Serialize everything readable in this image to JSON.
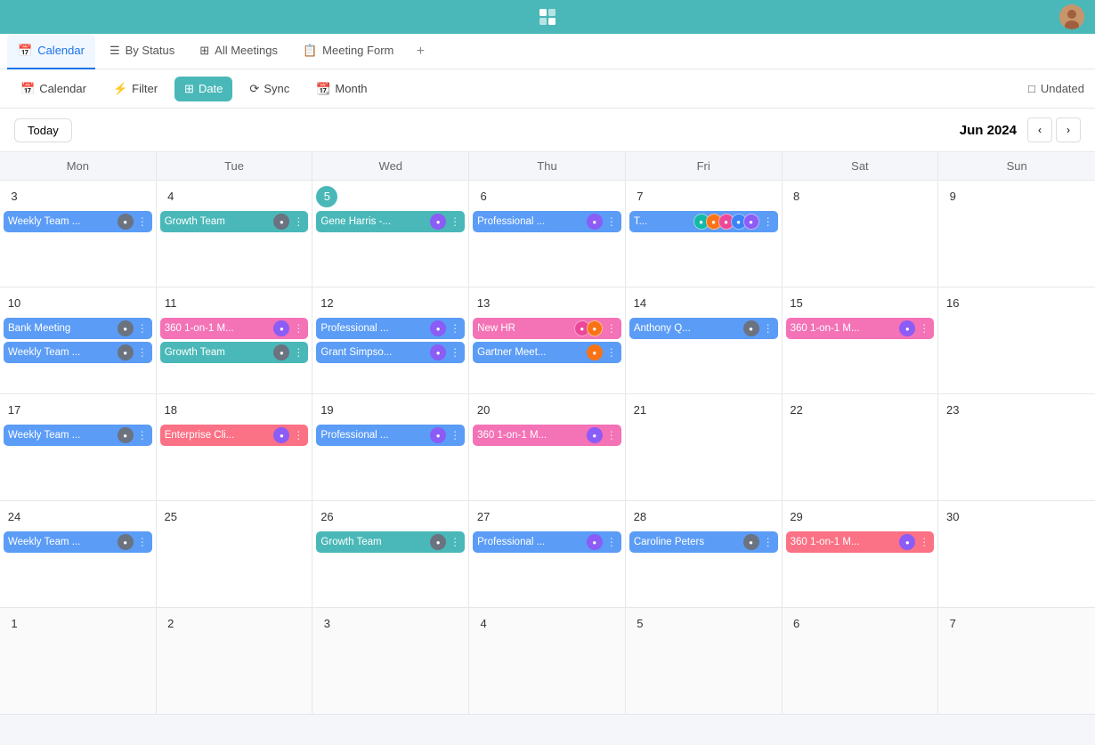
{
  "topbar": {
    "logo": "⊞",
    "avatar_alt": "User Avatar"
  },
  "tabs": [
    {
      "id": "calendar",
      "label": "Calendar",
      "icon": "📅",
      "active": true
    },
    {
      "id": "by-status",
      "label": "By Status",
      "icon": "☰"
    },
    {
      "id": "all-meetings",
      "label": "All Meetings",
      "icon": "⊞"
    },
    {
      "id": "meeting-form",
      "label": "Meeting Form",
      "icon": "📋"
    }
  ],
  "tab_add": "+",
  "toolbar": {
    "calendar_btn": "Calendar",
    "filter_btn": "Filter",
    "date_btn": "Date",
    "sync_btn": "Sync",
    "month_btn": "Month",
    "undated_btn": "Undated"
  },
  "calendar": {
    "today_btn": "Today",
    "title": "Jun 2024",
    "nav_prev": "‹",
    "nav_next": "›",
    "days": [
      "Mon",
      "Tue",
      "Wed",
      "Thu",
      "Fri",
      "Sat",
      "Sun"
    ]
  },
  "weeks": [
    {
      "days": [
        {
          "num": "3",
          "events": [
            {
              "label": "Weekly Team ...",
              "color": "ev-blue",
              "av_color": "av-gray",
              "has_menu": true
            }
          ]
        },
        {
          "num": "4",
          "events": [
            {
              "label": "Growth Team",
              "color": "ev-teal",
              "av_color": "av-gray",
              "has_menu": true
            }
          ]
        },
        {
          "num": "5",
          "today": true,
          "events": [
            {
              "label": "Gene Harris -...",
              "color": "ev-teal",
              "av_color": "av-purple",
              "has_menu": true
            }
          ]
        },
        {
          "num": "6",
          "events": [
            {
              "label": "Professional ...",
              "color": "ev-blue",
              "av_color": "av-purple",
              "has_menu": true
            }
          ]
        },
        {
          "num": "7",
          "events": [
            {
              "label": "T...",
              "color": "ev-blue",
              "multi_av": true,
              "has_menu": true
            }
          ]
        },
        {
          "num": "8",
          "events": []
        },
        {
          "num": "9",
          "events": []
        }
      ]
    },
    {
      "days": [
        {
          "num": "10",
          "events": [
            {
              "label": "Bank Meeting",
              "color": "ev-blue",
              "av_color": "av-gray",
              "has_menu": true
            },
            {
              "label": "Weekly Team ...",
              "color": "ev-blue",
              "av_color": "av-gray",
              "has_menu": true
            }
          ]
        },
        {
          "num": "11",
          "events": [
            {
              "label": "360 1-on-1 M...",
              "color": "ev-pink",
              "av_color": "av-purple",
              "has_menu": true
            },
            {
              "label": "Growth Team",
              "color": "ev-teal",
              "av_color": "av-gray",
              "has_menu": true
            }
          ]
        },
        {
          "num": "12",
          "events": [
            {
              "label": "Professional ...",
              "color": "ev-blue",
              "av_color": "av-purple",
              "has_menu": true
            },
            {
              "label": "Grant Simpso...",
              "color": "ev-blue",
              "av_color": "av-purple",
              "has_menu": true
            }
          ]
        },
        {
          "num": "13",
          "events": [
            {
              "label": "New HR",
              "color": "ev-pink",
              "multi_av2": true,
              "has_menu": true
            },
            {
              "label": "Gartner Meet...",
              "color": "ev-blue",
              "av_color": "av-orange",
              "has_menu": true
            }
          ]
        },
        {
          "num": "14",
          "events": [
            {
              "label": "Anthony Q...",
              "color": "ev-blue",
              "av_color": "av-gray",
              "has_menu": true
            }
          ]
        },
        {
          "num": "15",
          "events": [
            {
              "label": "360 1-on-1 M...",
              "color": "ev-pink",
              "av_color": "av-purple",
              "has_menu": true
            }
          ]
        },
        {
          "num": "16",
          "events": []
        }
      ]
    },
    {
      "days": [
        {
          "num": "17",
          "events": [
            {
              "label": "Weekly Team ...",
              "color": "ev-blue",
              "av_color": "av-gray",
              "has_menu": true
            }
          ]
        },
        {
          "num": "18",
          "events": [
            {
              "label": "Enterprise Cli...",
              "color": "ev-coral",
              "av_color": "av-purple",
              "has_menu": true
            }
          ]
        },
        {
          "num": "19",
          "events": [
            {
              "label": "Professional ...",
              "color": "ev-blue",
              "av_color": "av-purple",
              "has_menu": true
            }
          ]
        },
        {
          "num": "20",
          "events": [
            {
              "label": "360 1-on-1 M...",
              "color": "ev-pink",
              "av_color": "av-purple",
              "has_menu": true
            }
          ]
        },
        {
          "num": "21",
          "events": []
        },
        {
          "num": "22",
          "events": []
        },
        {
          "num": "23",
          "events": []
        }
      ]
    },
    {
      "days": [
        {
          "num": "24",
          "events": [
            {
              "label": "Weekly Team ...",
              "color": "ev-blue",
              "av_color": "av-gray",
              "has_menu": true
            }
          ]
        },
        {
          "num": "25",
          "events": []
        },
        {
          "num": "26",
          "events": [
            {
              "label": "Growth Team",
              "color": "ev-teal",
              "av_color": "av-gray",
              "has_menu": true
            }
          ]
        },
        {
          "num": "27",
          "events": [
            {
              "label": "Professional ...",
              "color": "ev-blue",
              "av_color": "av-purple",
              "has_menu": true
            }
          ]
        },
        {
          "num": "28",
          "events": [
            {
              "label": "Caroline Peters",
              "color": "ev-blue",
              "av_color": "av-gray",
              "has_menu": true
            }
          ]
        },
        {
          "num": "29",
          "events": [
            {
              "label": "360 1-on-1 M...",
              "color": "ev-coral",
              "av_color": "av-purple",
              "has_menu": true
            }
          ]
        },
        {
          "num": "30",
          "events": []
        }
      ]
    },
    {
      "days": [
        {
          "num": "1",
          "other": true,
          "events": []
        },
        {
          "num": "2",
          "other": true,
          "events": []
        },
        {
          "num": "3",
          "other": true,
          "events": []
        },
        {
          "num": "4",
          "other": true,
          "events": []
        },
        {
          "num": "5",
          "other": true,
          "events": []
        },
        {
          "num": "6",
          "other": true,
          "events": []
        },
        {
          "num": "7",
          "other": true,
          "events": []
        }
      ]
    }
  ]
}
